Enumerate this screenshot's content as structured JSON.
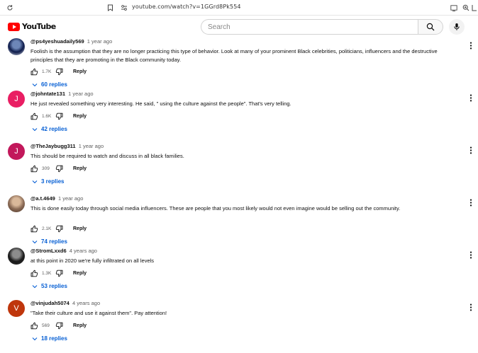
{
  "browser": {
    "url": "youtube.com/watch?v=1GGrd8Pk554"
  },
  "header": {
    "logo_text": "YouTube",
    "search_placeholder": "Search"
  },
  "comments": [
    {
      "author": "@ps4yeshuadaily569",
      "time": "1 year ago",
      "text": "Foolish is the assumption that they are no longer practicing this type of behavior. Look at many of your prominent Black celebrities, politicians, influencers and the destructive principles that they are promoting in the Black community today.",
      "likes": "1.7K",
      "reply_label": "Reply",
      "replies": "60 replies",
      "avatar": {
        "type": "image",
        "colors": [
          "#0d1b4a",
          "#6d86b8",
          "#d8dde8"
        ]
      }
    },
    {
      "author": "@johntate131",
      "time": "1 year ago",
      "text": "He just revealed something very interesting. He said, \" using the culture against the people\". That's very telling.",
      "likes": "1.6K",
      "reply_label": "Reply",
      "replies": "42 replies",
      "avatar": {
        "type": "letter",
        "letter": "J",
        "color": "#e91e63"
      }
    },
    {
      "author": "@TheJaybugg311",
      "time": "1 year ago",
      "text": "This should be required to watch and discuss in all black families.",
      "likes": "309",
      "reply_label": "Reply",
      "replies": "3 replies",
      "avatar": {
        "type": "letter",
        "letter": "J",
        "color": "#c2185b"
      }
    },
    {
      "author": "@a.t.4649",
      "time": "1 year ago",
      "text": "This is done easily today through social media influencers. These are people that you most likely would not even imagine would be selling out the community.",
      "likes": "2.1K",
      "reply_label": "Reply",
      "replies": "74 replies",
      "avatar": {
        "type": "image",
        "colors": [
          "#8a6a55",
          "#d9b89a",
          "#4a3528"
        ]
      }
    },
    {
      "author": "@StromLxxd6",
      "time": "4 years ago",
      "text": "at this point in 2020 we're fully infiltrated on all levels",
      "likes": "1.3K",
      "reply_label": "Reply",
      "replies": "53 replies",
      "avatar": {
        "type": "image",
        "colors": [
          "#1a1a1a",
          "#8c8c8c",
          "#2e2e2e"
        ]
      }
    },
    {
      "author": "@vinjudah5074",
      "time": "4 years ago",
      "text": "\"Take their culture and use it against them\". Pay attention!",
      "likes": "569",
      "reply_label": "Reply",
      "replies": "18 replies",
      "avatar": {
        "type": "letter",
        "letter": "V",
        "color": "#bf360c"
      }
    }
  ]
}
